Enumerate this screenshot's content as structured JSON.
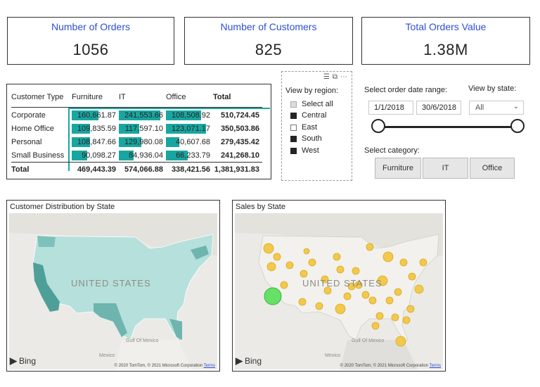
{
  "kpis": [
    {
      "label": "Number of Orders",
      "value": "1056"
    },
    {
      "label": "Number of Customers",
      "value": "825"
    },
    {
      "label": "Total Orders Value",
      "value": "1.38M"
    }
  ],
  "matrix": {
    "headers": [
      "Customer Type",
      "Furniture",
      "IT",
      "Office",
      "Total"
    ],
    "rows": [
      {
        "label": "Corporate",
        "furniture": "160,661.87",
        "it": "241,553.66",
        "office": "108,508.92",
        "total": "510,724.45",
        "bars": [
          0.64,
          0.98,
          0.84
        ]
      },
      {
        "label": "Home Office",
        "furniture": "109,835.59",
        "it": "117,597.10",
        "office": "123,071.17",
        "total": "350,503.86",
        "bars": [
          0.44,
          0.48,
          0.95
        ]
      },
      {
        "label": "Personal",
        "furniture": "108,847.66",
        "it": "129,980.08",
        "office": "40,607.68",
        "total": "279,435.42",
        "bars": [
          0.44,
          0.53,
          0.31
        ]
      },
      {
        "label": "Small Business",
        "furniture": "90,098.27",
        "it": "84,936.04",
        "office": "66,233.79",
        "total": "241,268.10",
        "bars": [
          0.36,
          0.35,
          0.51
        ]
      }
    ],
    "total_row": {
      "label": "Total",
      "furniture": "469,443.39",
      "it": "574,066.88",
      "office": "338,421.56",
      "total": "1,381,931.83"
    }
  },
  "region_slicer": {
    "title": "View by region:",
    "items": [
      {
        "label": "Select all",
        "state": "partial"
      },
      {
        "label": "Central",
        "state": "checked"
      },
      {
        "label": "East",
        "state": "unchecked"
      },
      {
        "label": "South",
        "state": "checked"
      },
      {
        "label": "West",
        "state": "checked"
      }
    ]
  },
  "date_slicer": {
    "label": "Select order date range:",
    "start": "1/1/2018",
    "end": "30/6/2018",
    "range_fraction": [
      0,
      1
    ]
  },
  "state_slicer": {
    "label": "View by state:",
    "value": "All"
  },
  "category_slicer": {
    "label": "Select category:",
    "options": [
      "Furniture",
      "IT",
      "Office"
    ]
  },
  "maps": {
    "left": {
      "title": "Customer Distribution by State",
      "country_label": "UNITED STATES",
      "gulf_label": "Gulf Of Mexico",
      "mexico_label": "Mexico"
    },
    "right": {
      "title": "Sales by State",
      "country_label": "UNITED STATES",
      "gulf_label": "Gulf Of Mexico",
      "mexico_label": "Mexico"
    },
    "bing": "Bing",
    "copyright": "© 2020 TomTom, © 2021 Microsoft Corporation",
    "terms": "Terms"
  },
  "colors": {
    "accent": "#19a6a0",
    "kpi_label": "#2e4fd6",
    "bubble": "#f2c94c",
    "bubble_highlight": "#66e066",
    "choropleth_light": "#b6e0dc",
    "choropleth_dark": "#4f9f99"
  }
}
